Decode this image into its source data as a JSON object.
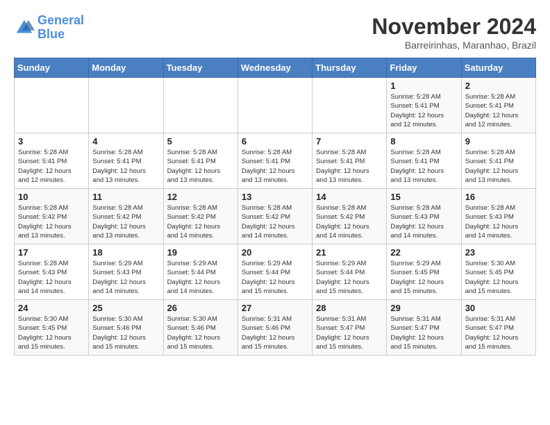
{
  "logo": {
    "line1": "General",
    "line2": "Blue"
  },
  "title": "November 2024",
  "subtitle": "Barreirinhas, Maranhao, Brazil",
  "days_of_week": [
    "Sunday",
    "Monday",
    "Tuesday",
    "Wednesday",
    "Thursday",
    "Friday",
    "Saturday"
  ],
  "weeks": [
    [
      {
        "day": "",
        "info": ""
      },
      {
        "day": "",
        "info": ""
      },
      {
        "day": "",
        "info": ""
      },
      {
        "day": "",
        "info": ""
      },
      {
        "day": "",
        "info": ""
      },
      {
        "day": "1",
        "info": "Sunrise: 5:28 AM\nSunset: 5:41 PM\nDaylight: 12 hours\nand 12 minutes."
      },
      {
        "day": "2",
        "info": "Sunrise: 5:28 AM\nSunset: 5:41 PM\nDaylight: 12 hours\nand 12 minutes."
      }
    ],
    [
      {
        "day": "3",
        "info": "Sunrise: 5:28 AM\nSunset: 5:41 PM\nDaylight: 12 hours\nand 12 minutes."
      },
      {
        "day": "4",
        "info": "Sunrise: 5:28 AM\nSunset: 5:41 PM\nDaylight: 12 hours\nand 13 minutes."
      },
      {
        "day": "5",
        "info": "Sunrise: 5:28 AM\nSunset: 5:41 PM\nDaylight: 12 hours\nand 13 minutes."
      },
      {
        "day": "6",
        "info": "Sunrise: 5:28 AM\nSunset: 5:41 PM\nDaylight: 12 hours\nand 13 minutes."
      },
      {
        "day": "7",
        "info": "Sunrise: 5:28 AM\nSunset: 5:41 PM\nDaylight: 12 hours\nand 13 minutes."
      },
      {
        "day": "8",
        "info": "Sunrise: 5:28 AM\nSunset: 5:41 PM\nDaylight: 12 hours\nand 13 minutes."
      },
      {
        "day": "9",
        "info": "Sunrise: 5:28 AM\nSunset: 5:41 PM\nDaylight: 12 hours\nand 13 minutes."
      }
    ],
    [
      {
        "day": "10",
        "info": "Sunrise: 5:28 AM\nSunset: 5:42 PM\nDaylight: 12 hours\nand 13 minutes."
      },
      {
        "day": "11",
        "info": "Sunrise: 5:28 AM\nSunset: 5:42 PM\nDaylight: 12 hours\nand 13 minutes."
      },
      {
        "day": "12",
        "info": "Sunrise: 5:28 AM\nSunset: 5:42 PM\nDaylight: 12 hours\nand 14 minutes."
      },
      {
        "day": "13",
        "info": "Sunrise: 5:28 AM\nSunset: 5:42 PM\nDaylight: 12 hours\nand 14 minutes."
      },
      {
        "day": "14",
        "info": "Sunrise: 5:28 AM\nSunset: 5:42 PM\nDaylight: 12 hours\nand 14 minutes."
      },
      {
        "day": "15",
        "info": "Sunrise: 5:28 AM\nSunset: 5:43 PM\nDaylight: 12 hours\nand 14 minutes."
      },
      {
        "day": "16",
        "info": "Sunrise: 5:28 AM\nSunset: 5:43 PM\nDaylight: 12 hours\nand 14 minutes."
      }
    ],
    [
      {
        "day": "17",
        "info": "Sunrise: 5:28 AM\nSunset: 5:43 PM\nDaylight: 12 hours\nand 14 minutes."
      },
      {
        "day": "18",
        "info": "Sunrise: 5:29 AM\nSunset: 5:43 PM\nDaylight: 12 hours\nand 14 minutes."
      },
      {
        "day": "19",
        "info": "Sunrise: 5:29 AM\nSunset: 5:44 PM\nDaylight: 12 hours\nand 14 minutes."
      },
      {
        "day": "20",
        "info": "Sunrise: 5:29 AM\nSunset: 5:44 PM\nDaylight: 12 hours\nand 15 minutes."
      },
      {
        "day": "21",
        "info": "Sunrise: 5:29 AM\nSunset: 5:44 PM\nDaylight: 12 hours\nand 15 minutes."
      },
      {
        "day": "22",
        "info": "Sunrise: 5:29 AM\nSunset: 5:45 PM\nDaylight: 12 hours\nand 15 minutes."
      },
      {
        "day": "23",
        "info": "Sunrise: 5:30 AM\nSunset: 5:45 PM\nDaylight: 12 hours\nand 15 minutes."
      }
    ],
    [
      {
        "day": "24",
        "info": "Sunrise: 5:30 AM\nSunset: 5:45 PM\nDaylight: 12 hours\nand 15 minutes."
      },
      {
        "day": "25",
        "info": "Sunrise: 5:30 AM\nSunset: 5:46 PM\nDaylight: 12 hours\nand 15 minutes."
      },
      {
        "day": "26",
        "info": "Sunrise: 5:30 AM\nSunset: 5:46 PM\nDaylight: 12 hours\nand 15 minutes."
      },
      {
        "day": "27",
        "info": "Sunrise: 5:31 AM\nSunset: 5:46 PM\nDaylight: 12 hours\nand 15 minutes."
      },
      {
        "day": "28",
        "info": "Sunrise: 5:31 AM\nSunset: 5:47 PM\nDaylight: 12 hours\nand 15 minutes."
      },
      {
        "day": "29",
        "info": "Sunrise: 5:31 AM\nSunset: 5:47 PM\nDaylight: 12 hours\nand 15 minutes."
      },
      {
        "day": "30",
        "info": "Sunrise: 5:31 AM\nSunset: 5:47 PM\nDaylight: 12 hours\nand 15 minutes."
      }
    ]
  ]
}
